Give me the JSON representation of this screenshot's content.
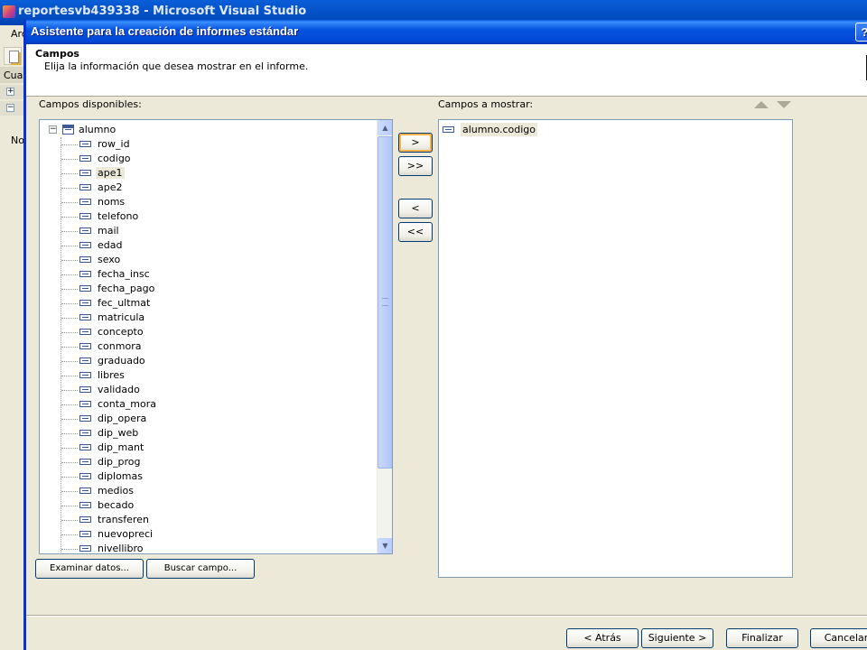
{
  "background_window": {
    "title": "reportesvb439338 - Microsoft Visual Studio",
    "menu_fragment": "Arc",
    "panel_fragment": "Cuad",
    "side_fragment": "No"
  },
  "dialog": {
    "title": "Asistente para la creación de informes estándar",
    "help_label": "?",
    "header": {
      "title": "Campos",
      "subtitle": "Elija la información que desea mostrar en el informe."
    },
    "available": {
      "label": "Campos disponibles:",
      "table_name": "alumno",
      "fields": [
        "row_id",
        "codigo",
        "ape1",
        "ape2",
        "noms",
        "telefono",
        "mail",
        "edad",
        "sexo",
        "fecha_insc",
        "fecha_pago",
        "fec_ultmat",
        "matricula",
        "concepto",
        "conmora",
        "graduado",
        "libres",
        "validado",
        "conta_mora",
        "dip_opera",
        "dip_web",
        "dip_mant",
        "dip_prog",
        "diplomas",
        "medios",
        "becado",
        "transferen",
        "nuevopreci",
        "nivellibro"
      ],
      "selected_field": "ape1"
    },
    "move_buttons": {
      "add_one": ">",
      "add_all": ">>",
      "remove_one": "<",
      "remove_all": "<<"
    },
    "display": {
      "label": "Campos a mostrar:",
      "items": [
        "alumno.codigo"
      ]
    },
    "bottom_left_buttons": {
      "browse_data": "Examinar datos...",
      "find_field": "Buscar campo..."
    },
    "nav_buttons": {
      "back": "< Atrás",
      "next": "Siguiente >",
      "finish": "Finalizar",
      "cancel": "Cancelar"
    }
  },
  "icons": {
    "expander_minus": "−",
    "expander_plus": "+",
    "scroll_up": "▲",
    "scroll_down": "▼"
  },
  "colors": {
    "dialog_title_blue": "#0553e0",
    "face": "#ece9d8",
    "list_border": "#7f9db9",
    "focus_orange": "#f8b34a"
  }
}
